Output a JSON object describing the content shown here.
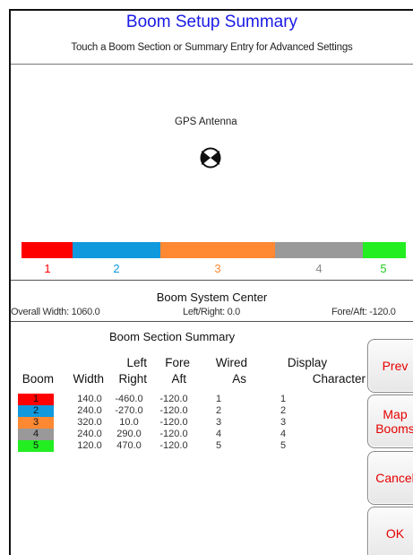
{
  "header": {
    "title": "Boom Setup Summary",
    "subtitle": "Touch a Boom Section or Summary Entry for Advanced Settings"
  },
  "gps": {
    "label": "GPS Antenna"
  },
  "boom_bar": [
    {
      "number": "1",
      "color": "#ff0000"
    },
    {
      "number": "2",
      "color": "#1199dd"
    },
    {
      "number": "3",
      "color": "#ff8833"
    },
    {
      "number": "4",
      "color": "#999999"
    },
    {
      "number": "5",
      "color": "#22ee22"
    }
  ],
  "system_center": {
    "title": "Boom System Center",
    "overall_width": "Overall Width: 1060.0",
    "left_right": "Left/Right: 0.0",
    "fore_aft": "Fore/Aft: -120.0"
  },
  "section_summary": {
    "title": "Boom Section Summary",
    "headers": {
      "boom": "Boom",
      "width": "Width",
      "left_right_1": "Left",
      "left_right_2": "Right",
      "fore_aft_1": "Fore",
      "fore_aft_2": "Aft",
      "wired_as_1": "Wired",
      "wired_as_2": "As",
      "display_1": "Display",
      "display_2": "Character"
    },
    "rows": [
      {
        "boom": "1",
        "width": "140.0",
        "left_right": "-460.0",
        "fore_aft": "-120.0",
        "wired_as": "1",
        "display": "1",
        "color": "#ff0000"
      },
      {
        "boom": "2",
        "width": "240.0",
        "left_right": "-270.0",
        "fore_aft": "-120.0",
        "wired_as": "2",
        "display": "2",
        "color": "#1199dd"
      },
      {
        "boom": "3",
        "width": "320.0",
        "left_right": "10.0",
        "fore_aft": "-120.0",
        "wired_as": "3",
        "display": "3",
        "color": "#ff8833"
      },
      {
        "boom": "4",
        "width": "240.0",
        "left_right": "290.0",
        "fore_aft": "-120.0",
        "wired_as": "4",
        "display": "4",
        "color": "#999999"
      },
      {
        "boom": "5",
        "width": "120.0",
        "left_right": "470.0",
        "fore_aft": "-120.0",
        "wired_as": "5",
        "display": "5",
        "color": "#22ee22"
      }
    ]
  },
  "buttons": {
    "prev": "Prev",
    "map_booms": "Map\nBooms",
    "cancel": "Cancel",
    "ok": "OK"
  }
}
